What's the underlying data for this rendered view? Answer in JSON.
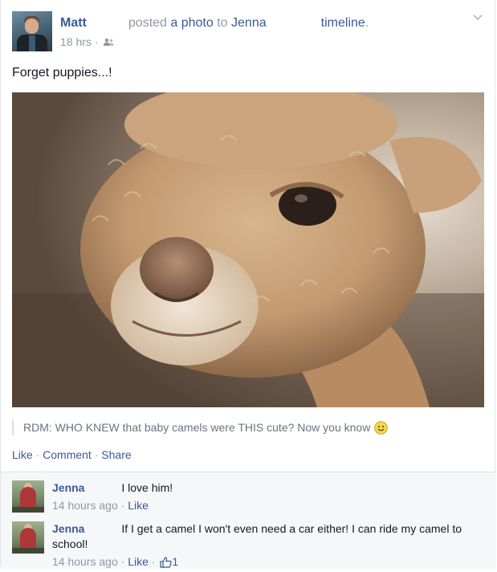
{
  "post": {
    "author": "Matt",
    "verb": "posted",
    "object": "a photo",
    "to_word": "to",
    "target": "Jenna",
    "timeline": "timeline",
    "period": ".",
    "time": "18 hrs",
    "separator": "·",
    "audience_icon": "friends-icon",
    "text": "Forget puppies...!",
    "caption": "RDM: WHO KNEW that baby camels were THIS cute? Now you know",
    "caption_icon": "smiley-emoticon"
  },
  "actions": {
    "like": "Like",
    "comment": "Comment",
    "share": "Share",
    "separator": "·"
  },
  "comments": [
    {
      "name": "Jenna",
      "text": "I love him!",
      "time": "14 hours ago",
      "like": "Like",
      "separator": "·"
    },
    {
      "name": "Jenna",
      "text": "If I get a camel I won't even need a car either! I can ride my camel to school!",
      "time": "14 hours ago",
      "like": "Like",
      "separator": "·",
      "like_count": "1"
    }
  ],
  "colors": {
    "link": "#3b5998",
    "muted": "#9197a3",
    "text": "#141823",
    "comments_bg": "#f6f7f9"
  }
}
